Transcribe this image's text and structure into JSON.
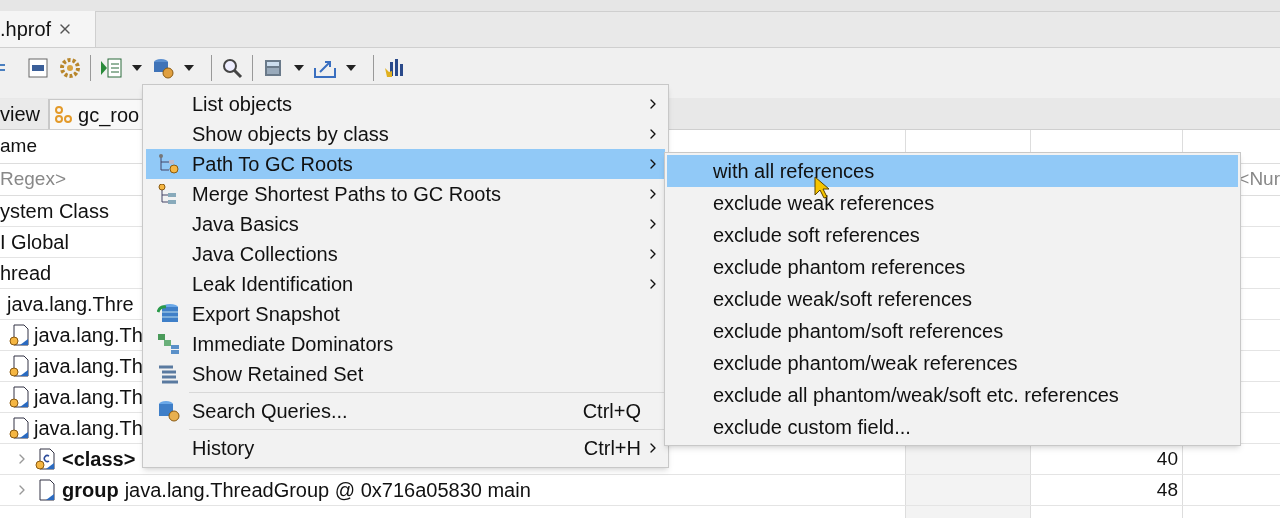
{
  "editor_tab": {
    "title": ".hprof"
  },
  "view_tabs": [
    {
      "label": "view",
      "selected": false
    },
    {
      "label": "gc_roo",
      "selected": true
    }
  ],
  "table": {
    "columns": [
      {
        "title": "ame"
      }
    ],
    "filter_row": {
      "name": "Regex>",
      "retained": "<Nur"
    },
    "rows": [
      {
        "kind": "root",
        "text": "ystem Class"
      },
      {
        "kind": "root",
        "text": "I Global"
      },
      {
        "kind": "root",
        "text": "hread",
        "children": [
          {
            "kind": "root",
            "text": "java.lang.Thre",
            "children": [
              {
                "kind": "object",
                "text": "java.lang.Th"
              },
              {
                "kind": "object",
                "text": "java.lang.Th"
              },
              {
                "kind": "object",
                "text": "java.lang.Th"
              },
              {
                "kind": "object",
                "text": "java.lang.Th",
                "children": [
                  {
                    "kind": "class",
                    "field": "<class>",
                    "value": "40"
                  },
                  {
                    "kind": "field",
                    "field": "group",
                    "text": "java.lang.ThreadGroup @ 0x716a05830  main",
                    "value": "48"
                  }
                ]
              }
            ]
          }
        ]
      }
    ]
  },
  "context_menu": {
    "items": [
      {
        "label": "List objects",
        "submenu": true,
        "selected": false
      },
      {
        "label": "Show objects by class",
        "submenu": true,
        "selected": false
      },
      {
        "label": "Path To GC Roots",
        "submenu": true,
        "selected": true
      },
      {
        "label": "Merge Shortest Paths to GC Roots",
        "submenu": true,
        "selected": false
      },
      {
        "label": "Java Basics",
        "submenu": true,
        "selected": false
      },
      {
        "label": "Java Collections",
        "submenu": true,
        "selected": false
      },
      {
        "label": "Leak Identification",
        "submenu": true,
        "selected": false
      },
      {
        "label": "Export Snapshot",
        "submenu": false,
        "selected": false
      },
      {
        "label": "Immediate Dominators",
        "submenu": false,
        "selected": false
      },
      {
        "label": "Show Retained Set",
        "submenu": false,
        "selected": false
      },
      {
        "label": "Search Queries...",
        "shortcut": "Ctrl+Q",
        "separator_before": true,
        "submenu": false,
        "selected": false
      },
      {
        "label": "History",
        "shortcut": "Ctrl+H",
        "separator_before": true,
        "submenu": true,
        "selected": false
      }
    ]
  },
  "submenu": {
    "items": [
      {
        "label": "with all references",
        "selected": true
      },
      {
        "label": "exclude weak references",
        "selected": false
      },
      {
        "label": "exclude soft references",
        "selected": false
      },
      {
        "label": "exclude phantom references",
        "selected": false
      },
      {
        "label": "exclude weak/soft references",
        "selected": false
      },
      {
        "label": "exclude phantom/soft references",
        "selected": false
      },
      {
        "label": "exclude phantom/weak references",
        "selected": false
      },
      {
        "label": "exclude all phantom/weak/soft etc. references",
        "selected": false
      },
      {
        "label": "exclude custom field...",
        "selected": false
      }
    ]
  }
}
